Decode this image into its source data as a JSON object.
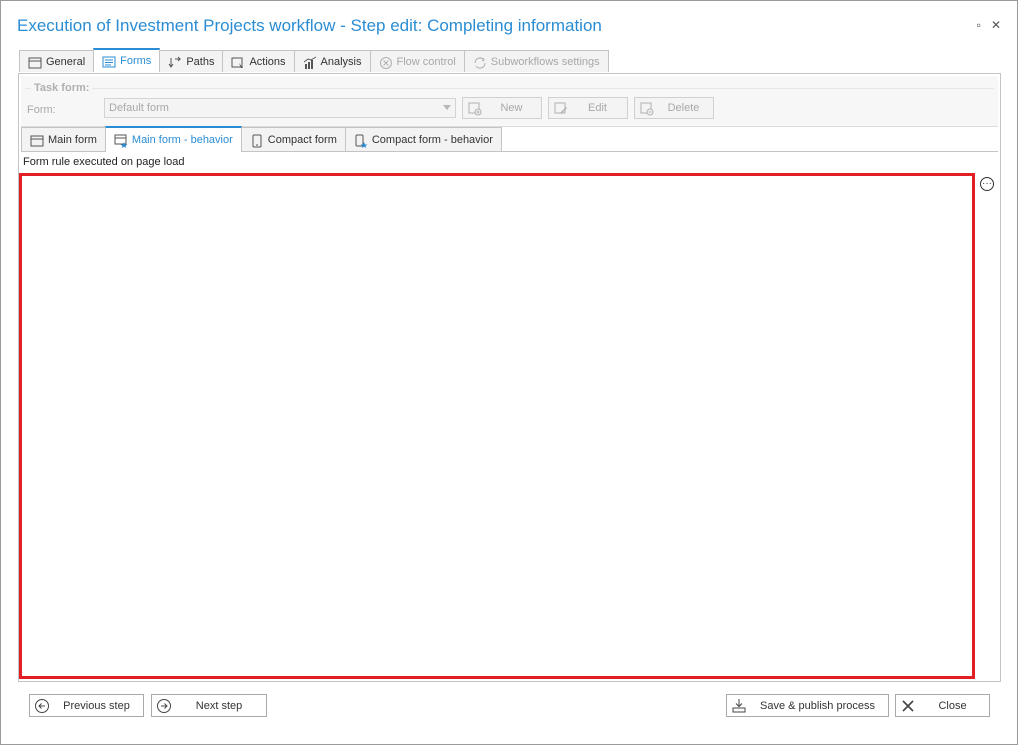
{
  "window": {
    "title": "Execution of Investment Projects workflow - Step edit: Completing information",
    "restore_glyph": "▫",
    "close_glyph": "✕"
  },
  "main_tabs": [
    {
      "label": "General",
      "icon": "window-icon",
      "state": "normal"
    },
    {
      "label": "Forms",
      "icon": "form-icon",
      "state": "active"
    },
    {
      "label": "Paths",
      "icon": "paths-icon",
      "state": "normal"
    },
    {
      "label": "Actions",
      "icon": "actions-icon",
      "state": "normal"
    },
    {
      "label": "Analysis",
      "icon": "analysis-icon",
      "state": "normal"
    },
    {
      "label": "Flow control",
      "icon": "flow-control-icon",
      "state": "disabled"
    },
    {
      "label": "Subworkflows settings",
      "icon": "subworkflows-icon",
      "state": "disabled"
    }
  ],
  "task_form": {
    "group_title": "Task form:",
    "form_label": "Form:",
    "form_value": "Default form",
    "new_label": "New",
    "edit_label": "Edit",
    "delete_label": "Delete"
  },
  "sub_tabs": [
    {
      "label": "Main form",
      "icon": "window-icon",
      "state": "normal"
    },
    {
      "label": "Main form - behavior",
      "icon": "behavior-icon",
      "state": "active"
    },
    {
      "label": "Compact form",
      "icon": "mobile-icon",
      "state": "normal"
    },
    {
      "label": "Compact form - behavior",
      "icon": "mobile-behavior-icon",
      "state": "normal"
    }
  ],
  "editor": {
    "label": "Form rule executed on page load",
    "more_glyph": "···"
  },
  "footer": {
    "previous_label": "Previous step",
    "next_label": "Next step",
    "save_label": "Save & publish process",
    "close_label": "Close"
  },
  "colors": {
    "accent": "#2a8dd4",
    "highlight_border": "#e31f26"
  }
}
